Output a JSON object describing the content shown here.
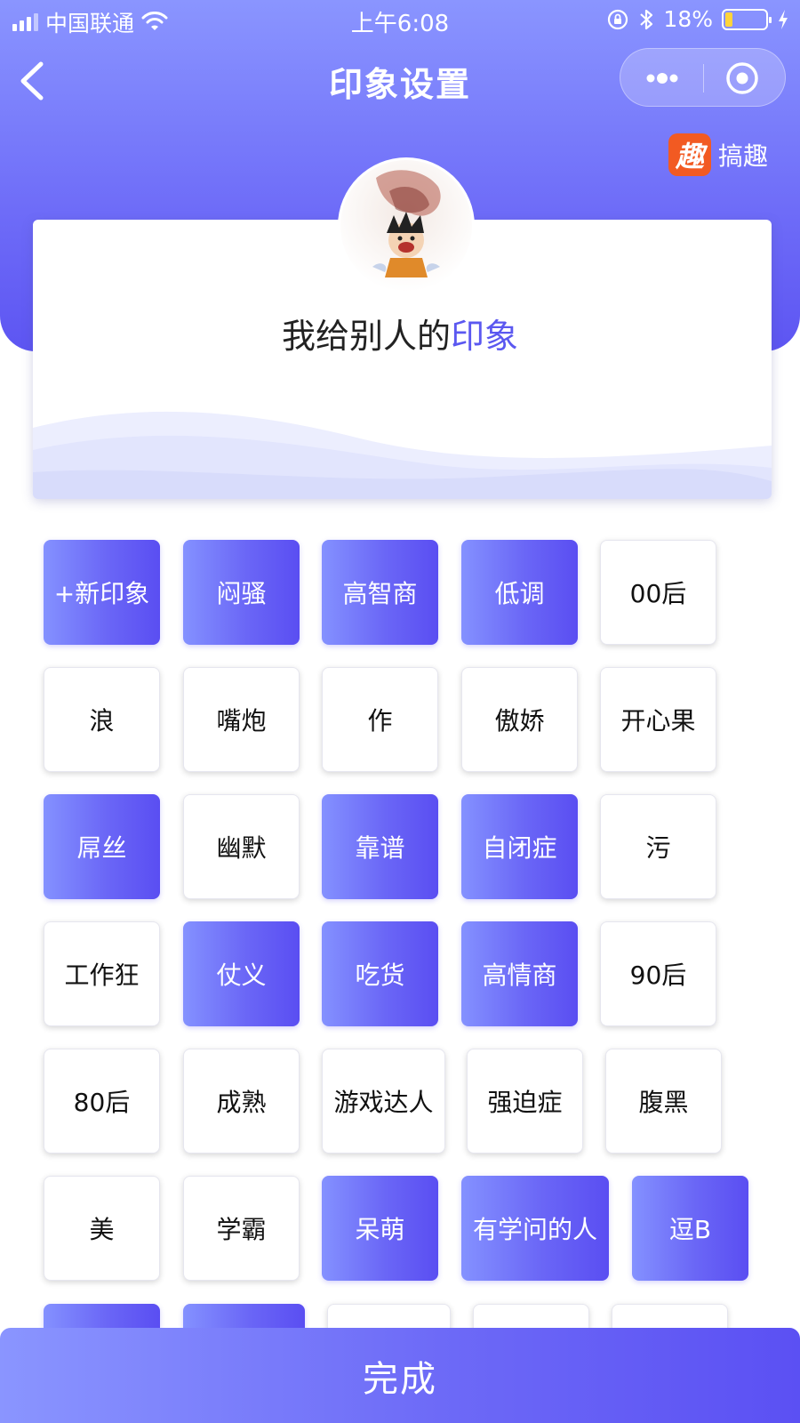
{
  "status_bar": {
    "carrier": "中国联通",
    "time": "上午6:08",
    "battery": "18%",
    "icons": [
      "signal-icon",
      "wifi-icon",
      "rotation-lock-icon",
      "bluetooth-icon",
      "battery-icon",
      "charging-icon"
    ]
  },
  "nav": {
    "title": "印象设置",
    "back_icon": "chevron-left-icon",
    "menu_icon": "more-dots-icon",
    "close_icon": "target-circle-icon"
  },
  "brand": {
    "logo_char": "趣",
    "name": "搞趣"
  },
  "card": {
    "title_prefix": "我给别人的",
    "title_accent": "印象"
  },
  "tags": [
    {
      "label": "+新印象",
      "selected": true
    },
    {
      "label": "闷骚",
      "selected": true
    },
    {
      "label": "高智商",
      "selected": true
    },
    {
      "label": "低调",
      "selected": true
    },
    {
      "label": "00后",
      "selected": false
    },
    {
      "label": "浪",
      "selected": false
    },
    {
      "label": "嘴炮",
      "selected": false
    },
    {
      "label": "作",
      "selected": false
    },
    {
      "label": "傲娇",
      "selected": false
    },
    {
      "label": "开心果",
      "selected": false
    },
    {
      "label": "屌丝",
      "selected": true
    },
    {
      "label": "幽默",
      "selected": false
    },
    {
      "label": "靠谱",
      "selected": true
    },
    {
      "label": "自闭症",
      "selected": true
    },
    {
      "label": "污",
      "selected": false
    },
    {
      "label": "工作狂",
      "selected": false
    },
    {
      "label": "仗义",
      "selected": true
    },
    {
      "label": "吃货",
      "selected": true
    },
    {
      "label": "高情商",
      "selected": true
    },
    {
      "label": "90后",
      "selected": false
    },
    {
      "label": "80后",
      "selected": false
    },
    {
      "label": "成熟",
      "selected": false
    },
    {
      "label": "游戏达人",
      "selected": false
    },
    {
      "label": "强迫症",
      "selected": false
    },
    {
      "label": "腹黑",
      "selected": false
    },
    {
      "label": "美",
      "selected": false
    },
    {
      "label": "学霸",
      "selected": false
    },
    {
      "label": "呆萌",
      "selected": true
    },
    {
      "label": "有学问的人",
      "selected": true
    },
    {
      "label": "逗B",
      "selected": true
    },
    {
      "label": "",
      "selected": true
    },
    {
      "label": "",
      "selected": true
    },
    {
      "label": "",
      "selected": false
    },
    {
      "label": "",
      "selected": false
    },
    {
      "label": "",
      "selected": false
    }
  ],
  "done_button": "完成",
  "colors": {
    "primary": "#6a66f6",
    "primary_light": "#8a95ff",
    "accent_text": "#5b58f0",
    "brand_orange": "#f25a22"
  }
}
